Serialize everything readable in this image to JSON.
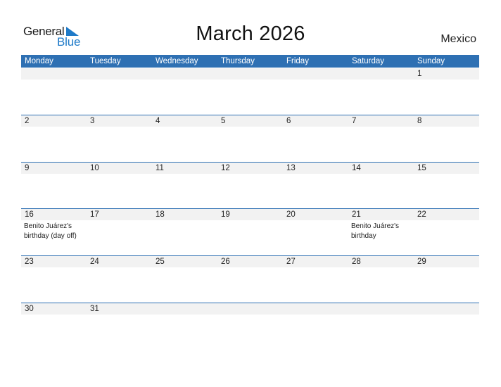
{
  "logo": {
    "general": "General",
    "blue": "Blue",
    "icon": "triangle-flag-icon"
  },
  "title": "March 2026",
  "country": "Mexico",
  "colors": {
    "header": "#2e70b3",
    "accent": "#1e7ac8",
    "date_strip": "#f2f2f2"
  },
  "weekdays": [
    "Monday",
    "Tuesday",
    "Wednesday",
    "Thursday",
    "Friday",
    "Saturday",
    "Sunday"
  ],
  "weeks": [
    {
      "days": [
        {
          "day": "",
          "holiday": ""
        },
        {
          "day": "",
          "holiday": ""
        },
        {
          "day": "",
          "holiday": ""
        },
        {
          "day": "",
          "holiday": ""
        },
        {
          "day": "",
          "holiday": ""
        },
        {
          "day": "",
          "holiday": ""
        },
        {
          "day": "1",
          "holiday": ""
        }
      ]
    },
    {
      "days": [
        {
          "day": "2",
          "holiday": ""
        },
        {
          "day": "3",
          "holiday": ""
        },
        {
          "day": "4",
          "holiday": ""
        },
        {
          "day": "5",
          "holiday": ""
        },
        {
          "day": "6",
          "holiday": ""
        },
        {
          "day": "7",
          "holiday": ""
        },
        {
          "day": "8",
          "holiday": ""
        }
      ]
    },
    {
      "days": [
        {
          "day": "9",
          "holiday": ""
        },
        {
          "day": "10",
          "holiday": ""
        },
        {
          "day": "11",
          "holiday": ""
        },
        {
          "day": "12",
          "holiday": ""
        },
        {
          "day": "13",
          "holiday": ""
        },
        {
          "day": "14",
          "holiday": ""
        },
        {
          "day": "15",
          "holiday": ""
        }
      ]
    },
    {
      "days": [
        {
          "day": "16",
          "holiday": "Benito Juárez's birthday (day off)"
        },
        {
          "day": "17",
          "holiday": ""
        },
        {
          "day": "18",
          "holiday": ""
        },
        {
          "day": "19",
          "holiday": ""
        },
        {
          "day": "20",
          "holiday": ""
        },
        {
          "day": "21",
          "holiday": "Benito Juárez's birthday"
        },
        {
          "day": "22",
          "holiday": ""
        }
      ]
    },
    {
      "days": [
        {
          "day": "23",
          "holiday": ""
        },
        {
          "day": "24",
          "holiday": ""
        },
        {
          "day": "25",
          "holiday": ""
        },
        {
          "day": "26",
          "holiday": ""
        },
        {
          "day": "27",
          "holiday": ""
        },
        {
          "day": "28",
          "holiday": ""
        },
        {
          "day": "29",
          "holiday": ""
        }
      ]
    },
    {
      "days": [
        {
          "day": "30",
          "holiday": ""
        },
        {
          "day": "31",
          "holiday": ""
        },
        {
          "day": "",
          "holiday": ""
        },
        {
          "day": "",
          "holiday": ""
        },
        {
          "day": "",
          "holiday": ""
        },
        {
          "day": "",
          "holiday": ""
        },
        {
          "day": "",
          "holiday": ""
        }
      ]
    }
  ]
}
